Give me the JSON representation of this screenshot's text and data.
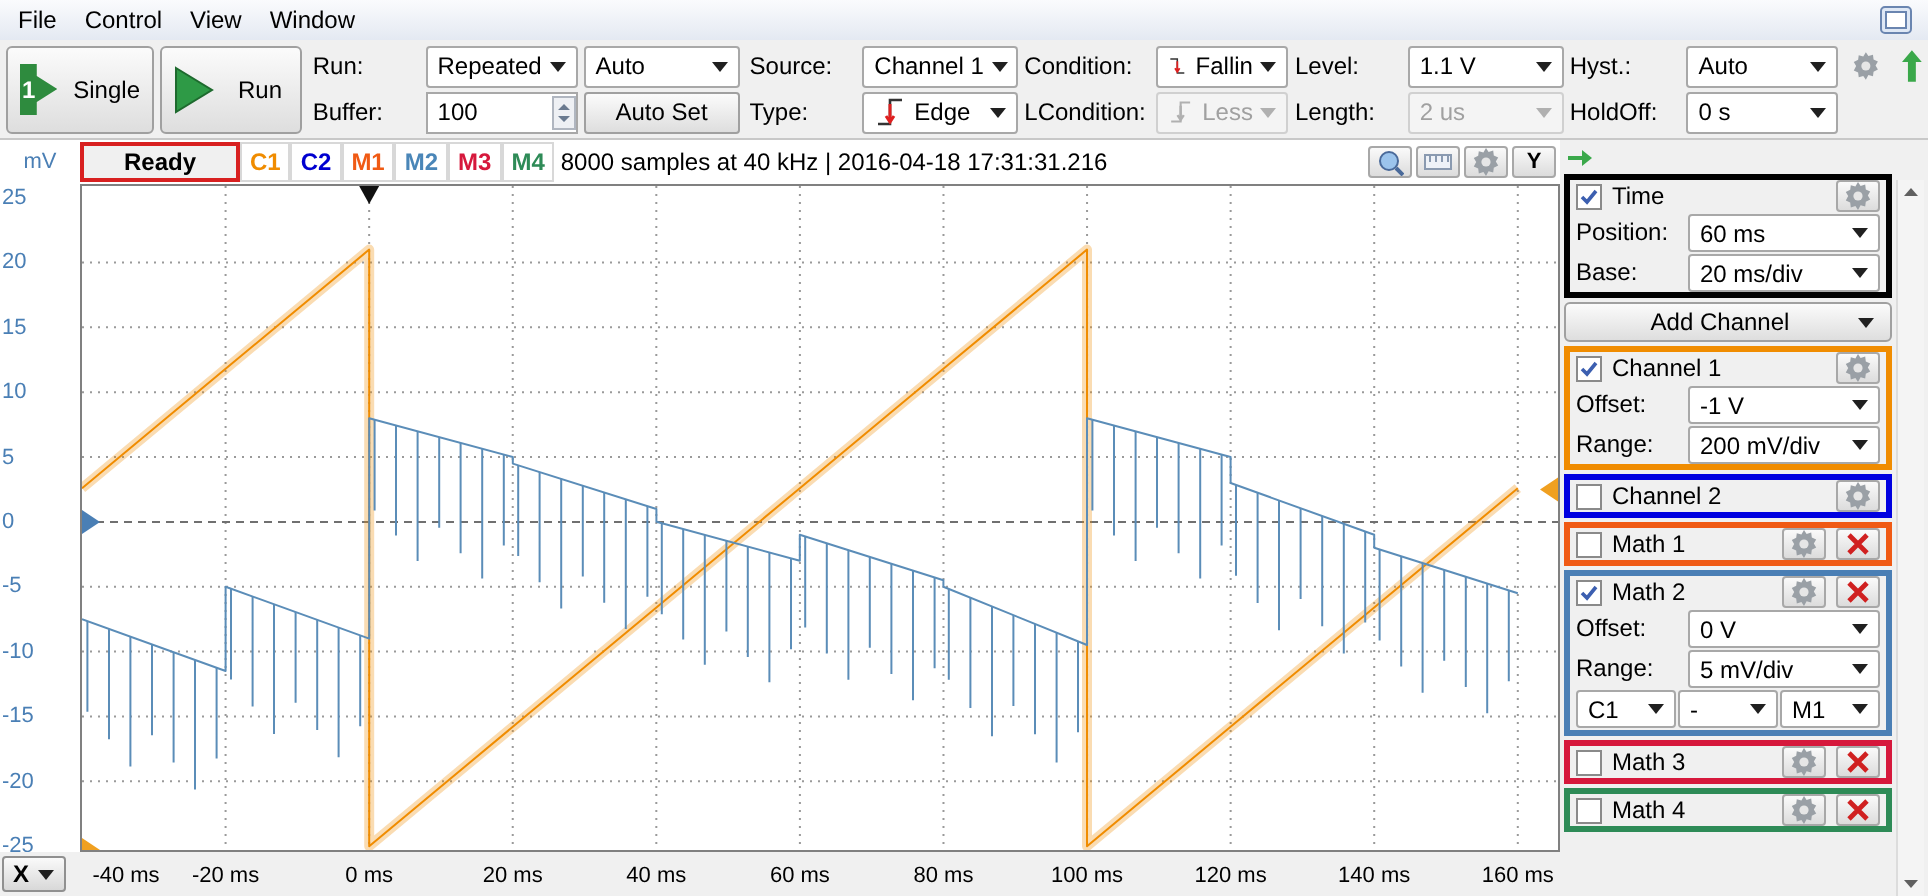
{
  "menu": [
    "File",
    "Control",
    "View",
    "Window"
  ],
  "toolbar": {
    "single_button": {
      "label": "Single",
      "badge": "1"
    },
    "run_button": "Run",
    "run": {
      "label": "Run:",
      "mode": "Repeated",
      "trigger_mode": "Auto"
    },
    "buffer": {
      "label": "Buffer:",
      "value": "100"
    },
    "auto_set_button": "Auto Set",
    "source": {
      "label": "Source:",
      "value": "Channel 1",
      "disabled": false
    },
    "type": {
      "label": "Type:",
      "value": "Edge",
      "disabled": false
    },
    "condition": {
      "label": "Condition:",
      "value": "Fallin",
      "disabled": false
    },
    "lcondition": {
      "label": "LCondition:",
      "value": "Less",
      "disabled": true
    },
    "level": {
      "label": "Level:",
      "value": "1.1 V",
      "disabled": false
    },
    "length": {
      "label": "Length:",
      "value": "2 us",
      "disabled": true
    },
    "hyst": {
      "label": "Hyst.:",
      "value": "Auto",
      "disabled": false
    },
    "holdoff": {
      "label": "HoldOff:",
      "value": "0 s",
      "disabled": false
    }
  },
  "status": {
    "unit": "mV",
    "state": "Ready",
    "info": "8000 samples at 40 kHz | 2016-04-18 17:31:31.216",
    "y_button": "Y",
    "traces": [
      {
        "label": "C1",
        "color": "#f08c00"
      },
      {
        "label": "C2",
        "color": "#0000d0"
      },
      {
        "label": "M1",
        "color": "#f05a14"
      },
      {
        "label": "M2",
        "color": "#4a86b8"
      },
      {
        "label": "M3",
        "color": "#d6183c"
      },
      {
        "label": "M4",
        "color": "#2e8b57"
      }
    ]
  },
  "plot": {
    "x_button": "X",
    "chart_data": {
      "type": "line",
      "x": [
        -40,
        -20,
        -20,
        0,
        0,
        20,
        20,
        40,
        40,
        60,
        60,
        80,
        80,
        100,
        100,
        120,
        120,
        140,
        140,
        160
      ],
      "series": [
        {
          "color": "#f08c00",
          "values": [
            2.6,
            11.8,
            11.8,
            21,
            -25,
            -15.8,
            -15.8,
            -6.6,
            -6.6,
            2.6,
            2.6,
            11.8,
            11.8,
            21,
            -25,
            -15.8,
            -15.8,
            -6.6,
            -6.6,
            2.6
          ]
        },
        {
          "color": "#5b8db8",
          "values": [
            -7.5,
            -11.5,
            -5,
            -9,
            8,
            5,
            4.5,
            1,
            0,
            -3,
            -1,
            -4.5,
            -5,
            -9.5,
            8,
            5,
            3,
            -1,
            -2,
            -5.5
          ]
        }
      ],
      "xlim": [
        -40,
        165.6
      ],
      "ylim": [
        -25.3,
        25.9
      ],
      "grid": true,
      "ref_lines": [
        {
          "axis": "y",
          "value": 0
        }
      ],
      "xticks": [
        {
          "value": -40,
          "label": "-40 ms"
        },
        {
          "value": -20,
          "label": "-20 ms"
        },
        {
          "value": 0,
          "label": "0 ms"
        },
        {
          "value": 20,
          "label": "20 ms"
        },
        {
          "value": 40,
          "label": "40 ms"
        },
        {
          "value": 60,
          "label": "60 ms"
        },
        {
          "value": 80,
          "label": "80 ms"
        },
        {
          "value": 100,
          "label": "100 ms"
        },
        {
          "value": 120,
          "label": "120 ms"
        },
        {
          "value": 140,
          "label": "140 ms"
        },
        {
          "value": 160,
          "label": "160 ms"
        }
      ],
      "yticks": [
        {
          "value": 25,
          "label": "25"
        },
        {
          "value": 20,
          "label": "20"
        },
        {
          "value": 15,
          "label": "15"
        },
        {
          "value": 10,
          "label": "10"
        },
        {
          "value": 5,
          "label": "5"
        },
        {
          "value": 0,
          "label": "0"
        },
        {
          "value": -5,
          "label": "-5"
        },
        {
          "value": -10,
          "label": "-10"
        },
        {
          "value": -15,
          "label": "-15"
        },
        {
          "value": -20,
          "label": "-20"
        },
        {
          "value": -25,
          "label": "-25"
        }
      ]
    }
  },
  "side_panel": {
    "time": {
      "title": "Time",
      "checked": true,
      "color": "#000000",
      "fields": [
        {
          "label": "Position:",
          "value": "60 ms"
        },
        {
          "label": "Base:",
          "value": "20 ms/div"
        }
      ]
    },
    "add_channel_button": "Add Channel",
    "channels": [
      {
        "title": "Channel 1",
        "checked": true,
        "removable": false,
        "color": "#f08c00",
        "fields": [
          {
            "label": "Offset:",
            "value": "-1 V"
          },
          {
            "label": "Range:",
            "value": "200 mV/div"
          }
        ]
      },
      {
        "title": "Channel 2",
        "checked": false,
        "removable": false,
        "color": "#0000e0"
      },
      {
        "title": "Math 1",
        "checked": false,
        "removable": true,
        "color": "#f05a14"
      },
      {
        "title": "Math 2",
        "checked": true,
        "removable": true,
        "color": "#4a7fb5",
        "fields": [
          {
            "label": "Offset:",
            "value": "0 V"
          },
          {
            "label": "Range:",
            "value": "5 mV/div"
          }
        ],
        "operands": [
          "C1",
          "-",
          "M1"
        ]
      },
      {
        "title": "Math 3",
        "checked": false,
        "removable": true,
        "color": "#d6183c"
      },
      {
        "title": "Math 4",
        "checked": false,
        "removable": true,
        "color": "#2e8b57"
      }
    ]
  }
}
